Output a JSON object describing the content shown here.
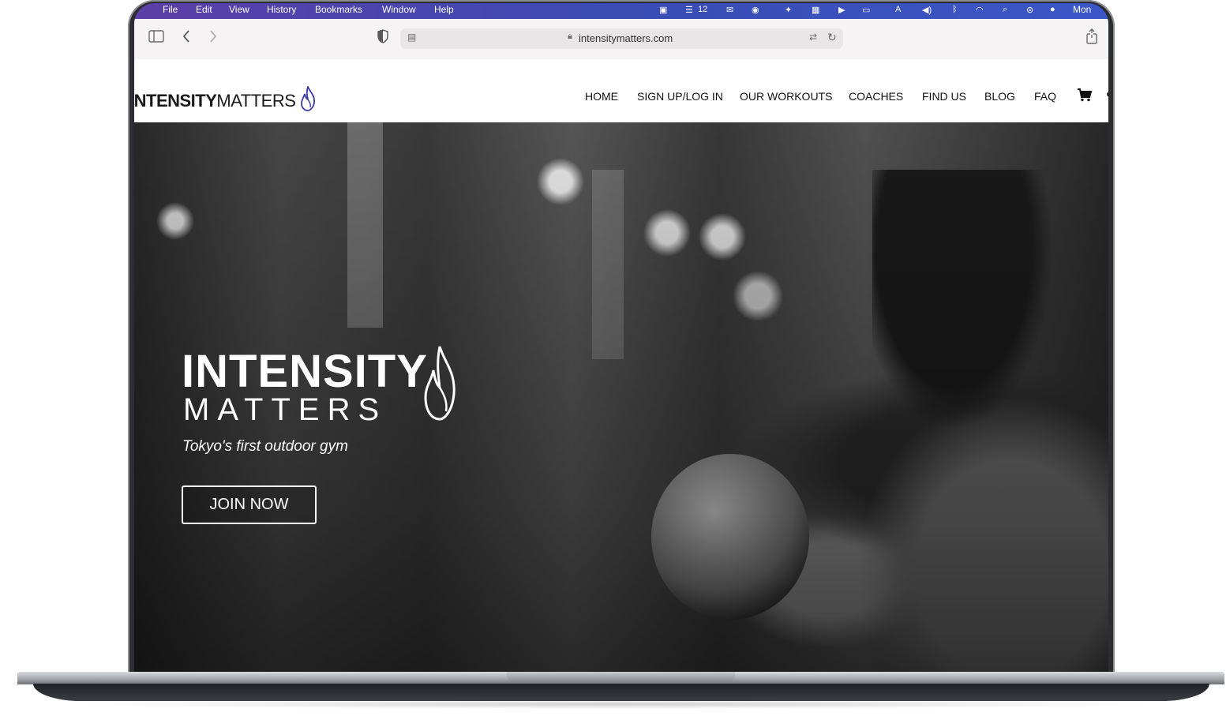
{
  "menubar": {
    "items": [
      "File",
      "Edit",
      "View",
      "History",
      "Bookmarks",
      "Window",
      "Help"
    ],
    "badge_count": "12",
    "clock": "Mon"
  },
  "browser": {
    "url": "intensitymatters.com"
  },
  "site": {
    "logo_bold": "INTENSITY",
    "logo_light": "MATTERS",
    "nav": [
      "HOME",
      "SIGN UP/LOG IN",
      "OUR WORKOUTS",
      "COACHES",
      "FIND US",
      "BLOG",
      "FAQ"
    ]
  },
  "hero": {
    "logo_line1": "INTENSITY",
    "logo_line2": "MATTERS",
    "tagline": "Tokyo's first outdoor gym",
    "cta": "JOIN NOW"
  },
  "colors": {
    "menubar_start": "#5b3fa6",
    "menubar_end": "#3b57c7",
    "flame": "#3a3aa8",
    "text": "#111111"
  }
}
